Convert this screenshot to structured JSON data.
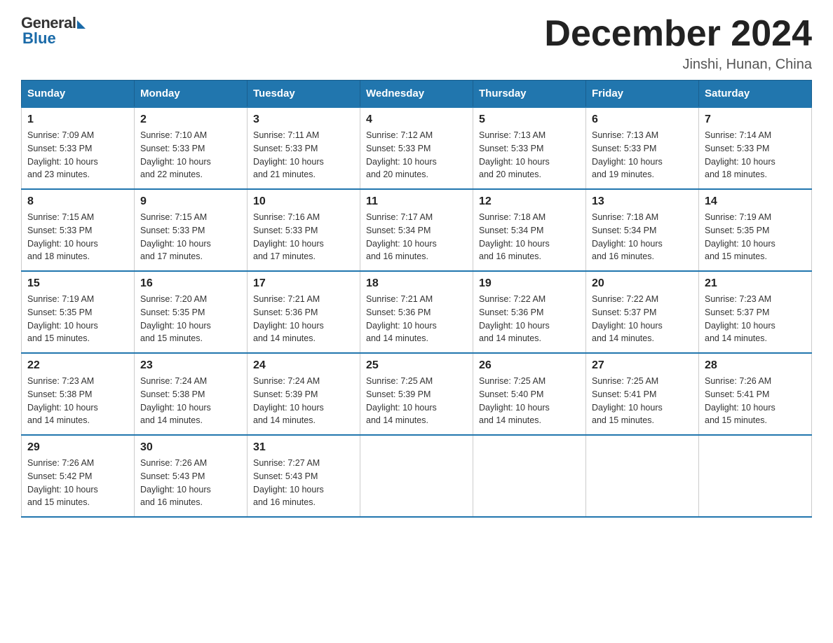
{
  "logo": {
    "general": "General",
    "blue": "Blue"
  },
  "title": "December 2024",
  "subtitle": "Jinshi, Hunan, China",
  "days_of_week": [
    "Sunday",
    "Monday",
    "Tuesday",
    "Wednesday",
    "Thursday",
    "Friday",
    "Saturday"
  ],
  "weeks": [
    [
      {
        "day": "1",
        "sunrise": "7:09 AM",
        "sunset": "5:33 PM",
        "daylight": "10 hours and 23 minutes."
      },
      {
        "day": "2",
        "sunrise": "7:10 AM",
        "sunset": "5:33 PM",
        "daylight": "10 hours and 22 minutes."
      },
      {
        "day": "3",
        "sunrise": "7:11 AM",
        "sunset": "5:33 PM",
        "daylight": "10 hours and 21 minutes."
      },
      {
        "day": "4",
        "sunrise": "7:12 AM",
        "sunset": "5:33 PM",
        "daylight": "10 hours and 20 minutes."
      },
      {
        "day": "5",
        "sunrise": "7:13 AM",
        "sunset": "5:33 PM",
        "daylight": "10 hours and 20 minutes."
      },
      {
        "day": "6",
        "sunrise": "7:13 AM",
        "sunset": "5:33 PM",
        "daylight": "10 hours and 19 minutes."
      },
      {
        "day": "7",
        "sunrise": "7:14 AM",
        "sunset": "5:33 PM",
        "daylight": "10 hours and 18 minutes."
      }
    ],
    [
      {
        "day": "8",
        "sunrise": "7:15 AM",
        "sunset": "5:33 PM",
        "daylight": "10 hours and 18 minutes."
      },
      {
        "day": "9",
        "sunrise": "7:15 AM",
        "sunset": "5:33 PM",
        "daylight": "10 hours and 17 minutes."
      },
      {
        "day": "10",
        "sunrise": "7:16 AM",
        "sunset": "5:33 PM",
        "daylight": "10 hours and 17 minutes."
      },
      {
        "day": "11",
        "sunrise": "7:17 AM",
        "sunset": "5:34 PM",
        "daylight": "10 hours and 16 minutes."
      },
      {
        "day": "12",
        "sunrise": "7:18 AM",
        "sunset": "5:34 PM",
        "daylight": "10 hours and 16 minutes."
      },
      {
        "day": "13",
        "sunrise": "7:18 AM",
        "sunset": "5:34 PM",
        "daylight": "10 hours and 16 minutes."
      },
      {
        "day": "14",
        "sunrise": "7:19 AM",
        "sunset": "5:35 PM",
        "daylight": "10 hours and 15 minutes."
      }
    ],
    [
      {
        "day": "15",
        "sunrise": "7:19 AM",
        "sunset": "5:35 PM",
        "daylight": "10 hours and 15 minutes."
      },
      {
        "day": "16",
        "sunrise": "7:20 AM",
        "sunset": "5:35 PM",
        "daylight": "10 hours and 15 minutes."
      },
      {
        "day": "17",
        "sunrise": "7:21 AM",
        "sunset": "5:36 PM",
        "daylight": "10 hours and 14 minutes."
      },
      {
        "day": "18",
        "sunrise": "7:21 AM",
        "sunset": "5:36 PM",
        "daylight": "10 hours and 14 minutes."
      },
      {
        "day": "19",
        "sunrise": "7:22 AM",
        "sunset": "5:36 PM",
        "daylight": "10 hours and 14 minutes."
      },
      {
        "day": "20",
        "sunrise": "7:22 AM",
        "sunset": "5:37 PM",
        "daylight": "10 hours and 14 minutes."
      },
      {
        "day": "21",
        "sunrise": "7:23 AM",
        "sunset": "5:37 PM",
        "daylight": "10 hours and 14 minutes."
      }
    ],
    [
      {
        "day": "22",
        "sunrise": "7:23 AM",
        "sunset": "5:38 PM",
        "daylight": "10 hours and 14 minutes."
      },
      {
        "day": "23",
        "sunrise": "7:24 AM",
        "sunset": "5:38 PM",
        "daylight": "10 hours and 14 minutes."
      },
      {
        "day": "24",
        "sunrise": "7:24 AM",
        "sunset": "5:39 PM",
        "daylight": "10 hours and 14 minutes."
      },
      {
        "day": "25",
        "sunrise": "7:25 AM",
        "sunset": "5:39 PM",
        "daylight": "10 hours and 14 minutes."
      },
      {
        "day": "26",
        "sunrise": "7:25 AM",
        "sunset": "5:40 PM",
        "daylight": "10 hours and 14 minutes."
      },
      {
        "day": "27",
        "sunrise": "7:25 AM",
        "sunset": "5:41 PM",
        "daylight": "10 hours and 15 minutes."
      },
      {
        "day": "28",
        "sunrise": "7:26 AM",
        "sunset": "5:41 PM",
        "daylight": "10 hours and 15 minutes."
      }
    ],
    [
      {
        "day": "29",
        "sunrise": "7:26 AM",
        "sunset": "5:42 PM",
        "daylight": "10 hours and 15 minutes."
      },
      {
        "day": "30",
        "sunrise": "7:26 AM",
        "sunset": "5:43 PM",
        "daylight": "10 hours and 16 minutes."
      },
      {
        "day": "31",
        "sunrise": "7:27 AM",
        "sunset": "5:43 PM",
        "daylight": "10 hours and 16 minutes."
      },
      null,
      null,
      null,
      null
    ]
  ],
  "sunrise_label": "Sunrise:",
  "sunset_label": "Sunset:",
  "daylight_label": "Daylight:"
}
